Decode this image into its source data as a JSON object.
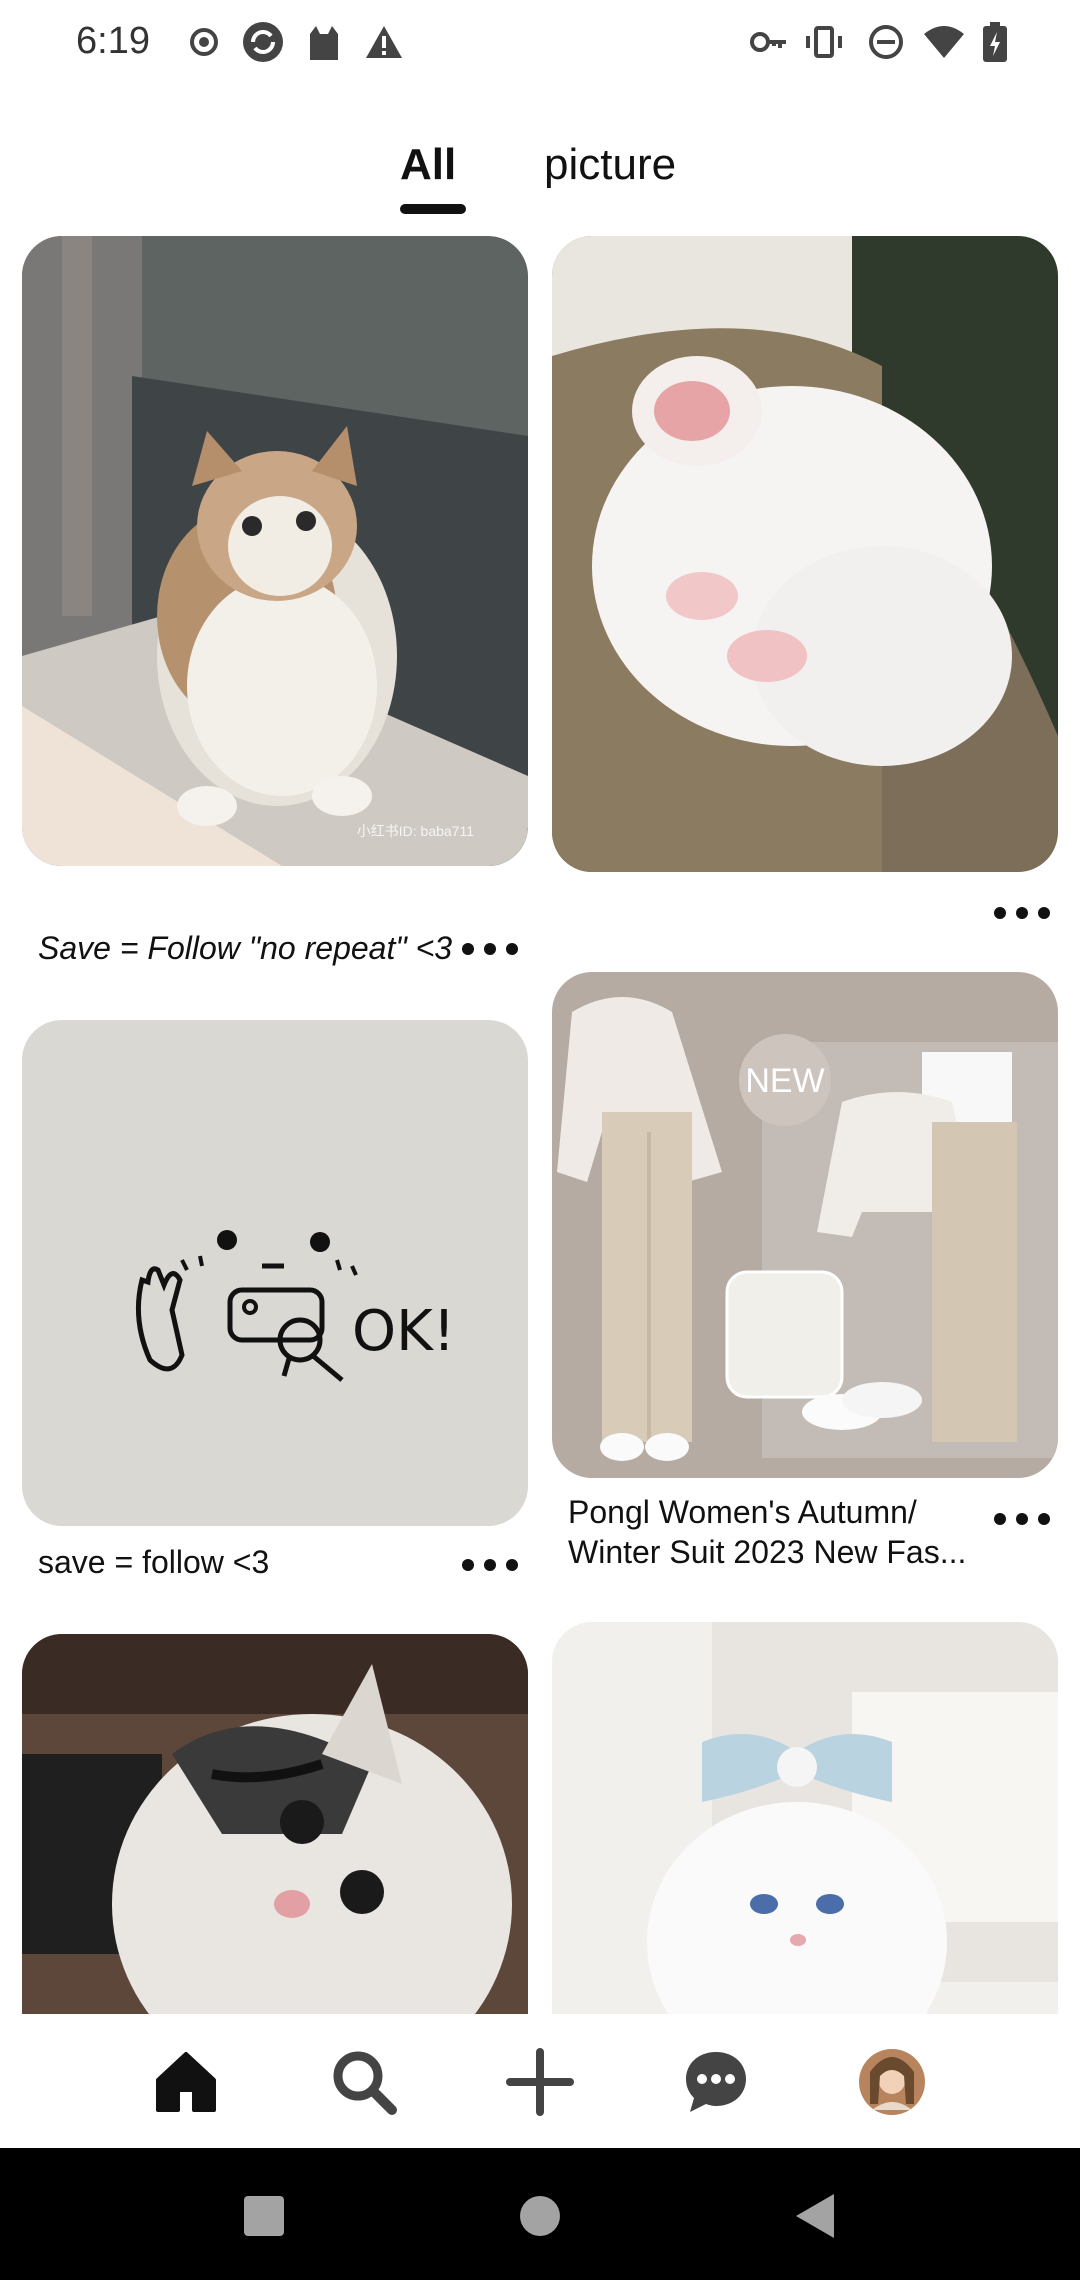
{
  "status_bar": {
    "time": "6:19",
    "left_icons": [
      "record-icon",
      "sync-icon",
      "cat-icon",
      "warning-icon"
    ],
    "right_icons": [
      "key-icon",
      "vibrate-icon",
      "dnd-icon",
      "wifi-icon",
      "battery-icon"
    ]
  },
  "tabs": [
    {
      "label": "All",
      "selected": true
    },
    {
      "label": "picture",
      "selected": false
    }
  ],
  "pins": [
    {
      "caption": "Save = Follow \"no repeat\" <3",
      "italic": true,
      "image": "fluffy cat in corner",
      "watermark": "小红书ID: baba711"
    },
    {
      "caption": "",
      "image": "sleeping white kitten"
    },
    {
      "caption": "save = follow <3",
      "image": "ok doodle on paper"
    },
    {
      "caption": "Pongl Women's Autumn/ Winter Suit 2023 New Fas...",
      "image": "beige outfit collage",
      "badge": "NEW"
    },
    {
      "caption": "",
      "image": "tabby kitten closeup"
    },
    {
      "caption": "",
      "image": "white cat with blue bow"
    }
  ],
  "doodle_text": "OK!",
  "bottom_nav": [
    "home-icon",
    "search-icon",
    "create-icon",
    "messages-icon",
    "profile-avatar"
  ],
  "system_nav": [
    "recents-icon",
    "home-circle-icon",
    "back-icon"
  ],
  "colors": {
    "accent": "#111111",
    "background": "#ffffff"
  }
}
